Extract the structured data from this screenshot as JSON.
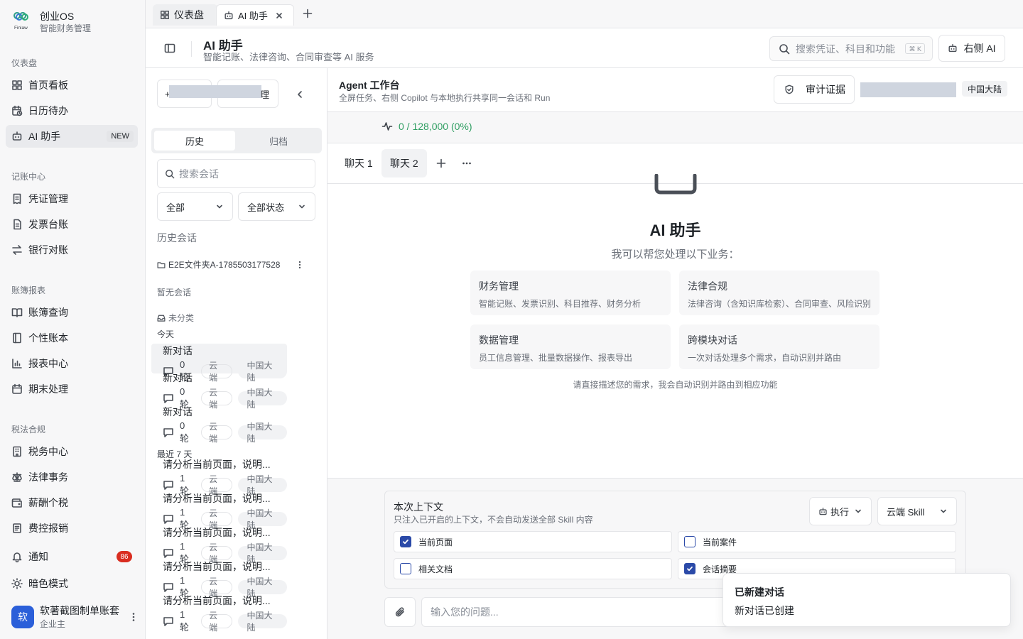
{
  "brand": {
    "logo_text": "Finlaw",
    "title": "创业OS",
    "subtitle": "智能财务管理"
  },
  "sidebar": {
    "sections": [
      {
        "label": "仪表盘",
        "items": [
          {
            "label": "首页看板",
            "icon": "grid-icon"
          },
          {
            "label": "日历待办",
            "icon": "calendar-clock-icon"
          },
          {
            "label": "AI 助手",
            "icon": "robot-icon",
            "badge": "NEW",
            "active": true
          }
        ]
      },
      {
        "label": "记账中心",
        "items": [
          {
            "label": "凭证管理",
            "icon": "receipt-icon"
          },
          {
            "label": "发票台账",
            "icon": "file-icon"
          },
          {
            "label": "银行对账",
            "icon": "swap-icon"
          }
        ]
      },
      {
        "label": "账簿报表",
        "items": [
          {
            "label": "账簿查询",
            "icon": "book-icon"
          },
          {
            "label": "个性账本",
            "icon": "notebook-icon"
          },
          {
            "label": "报表中心",
            "icon": "bar-chart-icon"
          },
          {
            "label": "期末处理",
            "icon": "calendar-icon"
          }
        ]
      },
      {
        "label": "税法合规",
        "items": [
          {
            "label": "税务中心",
            "icon": "building-icon"
          },
          {
            "label": "法律事务",
            "icon": "scale-icon"
          },
          {
            "label": "薪酬个税",
            "icon": "wallet-icon"
          },
          {
            "label": "费控报销",
            "icon": "card-icon"
          }
        ]
      }
    ],
    "notifications": {
      "label": "通知",
      "count": "86"
    },
    "dark_mode": {
      "label": "暗色模式"
    },
    "user": {
      "avatar": "软",
      "name": "软著截图制单账套",
      "role": "企业主"
    }
  },
  "tabs": [
    {
      "label": "仪表盘",
      "active": false
    },
    {
      "label": "AI 助手",
      "active": true
    }
  ],
  "header": {
    "title": "AI 助手",
    "subtitle": "智能记账、法律咨询、合同审查等 AI 服务",
    "search_placeholder": "搜索凭证、科目和功能",
    "shortcut": "⌘ K",
    "right_ai_label": "右侧 AI"
  },
  "history": {
    "new_button": "+",
    "manage_button": "理",
    "segments": [
      "历史",
      "归档"
    ],
    "search_placeholder": "搜索会话",
    "filter_scope": "全部",
    "filter_status": "全部状态",
    "section_label": "历史会话",
    "folder_name": "E2E文件夹A-1785503177528",
    "empty_label": "暂无会话",
    "uncategorized": "未分类",
    "groups": [
      {
        "label": "今天",
        "items": [
          {
            "title": "新对话",
            "turns": "0 轮",
            "mode": "云端",
            "region": "中国大陆",
            "selected": true
          },
          {
            "title": "新对话",
            "turns": "0 轮",
            "mode": "云端",
            "region": "中国大陆"
          },
          {
            "title": "新对话",
            "turns": "0 轮",
            "mode": "云端",
            "region": "中国大陆"
          }
        ]
      },
      {
        "label": "最近 7 天",
        "items": [
          {
            "title": "请分析当前页面，说明...",
            "turns": "1 轮",
            "mode": "云端",
            "region": "中国大陆"
          },
          {
            "title": "请分析当前页面，说明...",
            "turns": "1 轮",
            "mode": "云端",
            "region": "中国大陆"
          },
          {
            "title": "请分析当前页面，说明...",
            "turns": "1 轮",
            "mode": "云端",
            "region": "中国大陆"
          },
          {
            "title": "请分析当前页面，说明...",
            "turns": "1 轮",
            "mode": "云端",
            "region": "中国大陆"
          },
          {
            "title": "请分析当前页面，说明...",
            "turns": "1 轮",
            "mode": "云端",
            "region": "中国大陆"
          }
        ]
      }
    ]
  },
  "agent": {
    "title": "Agent 工作台",
    "subtitle": "全屏任务、右侧 Copilot 与本地执行共享同一会话和 Run",
    "audit_button": "审计证据",
    "region": "中国大陆",
    "token_usage": "0 / 128,000 (0%)"
  },
  "chat_tabs": [
    "聊天 1",
    "聊天 2"
  ],
  "welcome": {
    "title": "AI 助手",
    "subtitle": "我可以帮您处理以下业务：",
    "cards": [
      {
        "title": "财务管理",
        "desc": "智能记账、发票识别、科目推荐、财务分析"
      },
      {
        "title": "法律合规",
        "desc": "法律咨询（含知识库检索）、合同审查、风险识别"
      },
      {
        "title": "数据管理",
        "desc": "员工信息管理、批量数据操作、报表导出"
      },
      {
        "title": "跨模块对话",
        "desc": "一次对话处理多个需求，自动识别并路由"
      }
    ],
    "hint": "请直接描述您的需求，我会自动识别并路由到相应功能"
  },
  "context": {
    "title": "本次上下文",
    "subtitle": "只注入已开启的上下文，不会自动发送全部 Skill 内容",
    "exec_label": "执行",
    "skill_label": "云端 Skill",
    "options": [
      {
        "label": "当前页面",
        "checked": true
      },
      {
        "label": "当前案件",
        "checked": false
      },
      {
        "label": "相关文档",
        "checked": false
      },
      {
        "label": "会话摘要",
        "checked": true
      }
    ]
  },
  "composer": {
    "placeholder": "输入您的问题..."
  },
  "toast": {
    "title": "已新建对话",
    "desc": "新对话已创建"
  },
  "colors": {
    "accent": "#2b4aa8",
    "success": "#2f9e62",
    "danger": "#d92d20",
    "avatar": "#2b5fd9"
  }
}
